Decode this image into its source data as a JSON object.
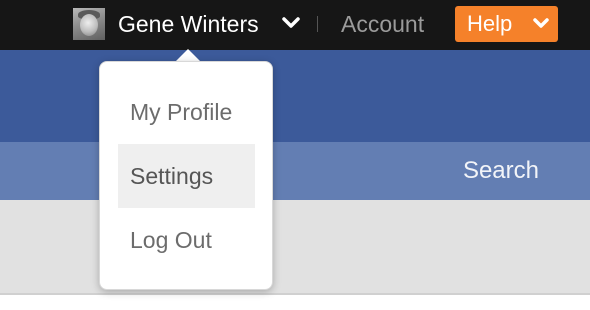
{
  "topbar": {
    "user": {
      "avatar_icon": "user-avatar-photo",
      "name": "Gene Winters",
      "chevron_icon": "chevron-down-icon"
    },
    "account_label": "Account",
    "help": {
      "label": "Help",
      "chevron_icon": "chevron-down-icon",
      "background_color": "#f5812a"
    },
    "background_color": "#161616"
  },
  "nav": {
    "search_label": "Search",
    "background_color": "#637eb3"
  },
  "header_band": {
    "background_color": "#3c5a9a"
  },
  "user_menu": {
    "items": [
      {
        "label": "My Profile",
        "active": false
      },
      {
        "label": "Settings",
        "active": true
      },
      {
        "label": "Log Out",
        "active": false
      }
    ],
    "highlight_color": "#efefef"
  }
}
